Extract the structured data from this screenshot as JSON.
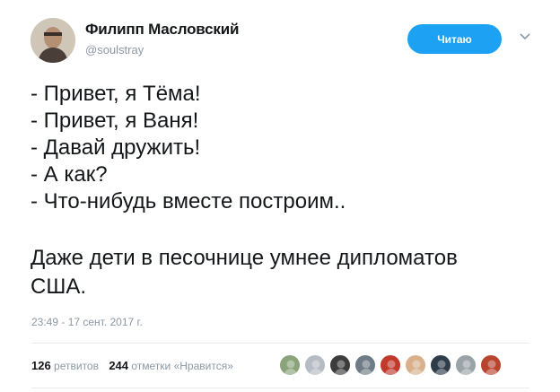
{
  "author": {
    "name": "Филипп Масловский",
    "handle": "@soulstray"
  },
  "follow_button": {
    "label": "Читаю",
    "color": "#1da1f2"
  },
  "tweet": {
    "lines": [
      "- Привет, я Тёма!",
      "- Привет, я Ваня!",
      "- Давай дружить!",
      "- А как?",
      "- Что-нибудь вместе построим.."
    ],
    "conclusion": [
      "Даже дети в песочнице умнее дипломатов",
      "США."
    ]
  },
  "timestamp": "23:49 - 17 сент. 2017 г.",
  "stats": {
    "retweets_count": "126",
    "retweets_label": "ретвитов",
    "likes_count": "244",
    "likes_label": "отметки «Нравится»"
  },
  "likers": [
    {
      "icon": "liker-avatar",
      "color": "#8aa37a"
    },
    {
      "icon": "default-avatar",
      "color": "#b5bcc4"
    },
    {
      "icon": "liker-avatar",
      "color": "#3c3c3c"
    },
    {
      "icon": "liker-avatar",
      "color": "#6f7b86"
    },
    {
      "icon": "liker-avatar",
      "color": "#c0392b"
    },
    {
      "icon": "liker-avatar",
      "color": "#d9b08c"
    },
    {
      "icon": "liker-avatar",
      "color": "#2f3d4a"
    },
    {
      "icon": "liker-avatar",
      "color": "#9aa3a8"
    },
    {
      "icon": "liker-avatar",
      "color": "#b8442e"
    }
  ]
}
